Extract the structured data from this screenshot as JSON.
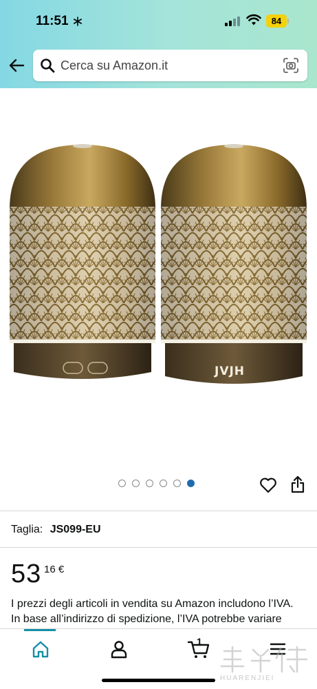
{
  "status_bar": {
    "time": "11:51",
    "battery": "84"
  },
  "header": {
    "search": {
      "placeholder": "Cerca su Amazon.it"
    }
  },
  "product": {
    "brand_on_device": "JVJH",
    "gallery": {
      "count": 6,
      "active_index": 5
    },
    "size": {
      "label": "Taglia:",
      "value": "JS099-EU"
    },
    "price": {
      "whole": "53",
      "fraction": "16 €"
    },
    "vat_note_line1": "I prezzi degli articoli in vendita su Amazon includono l’IVA.",
    "vat_note_line2": "In base all’indirizzo di spedizione, l’IVA potrebbe variare"
  },
  "bottom_nav": {
    "cart_count": "1"
  },
  "watermark": {
    "text": "HUARENJIEI"
  },
  "colors": {
    "header_gradient_start": "#84d8e3",
    "header_gradient_end": "#a9e6cd",
    "active_accent": "#1590a6",
    "dot_active": "#1f6bb0",
    "bronze": "#8a6a2a"
  }
}
